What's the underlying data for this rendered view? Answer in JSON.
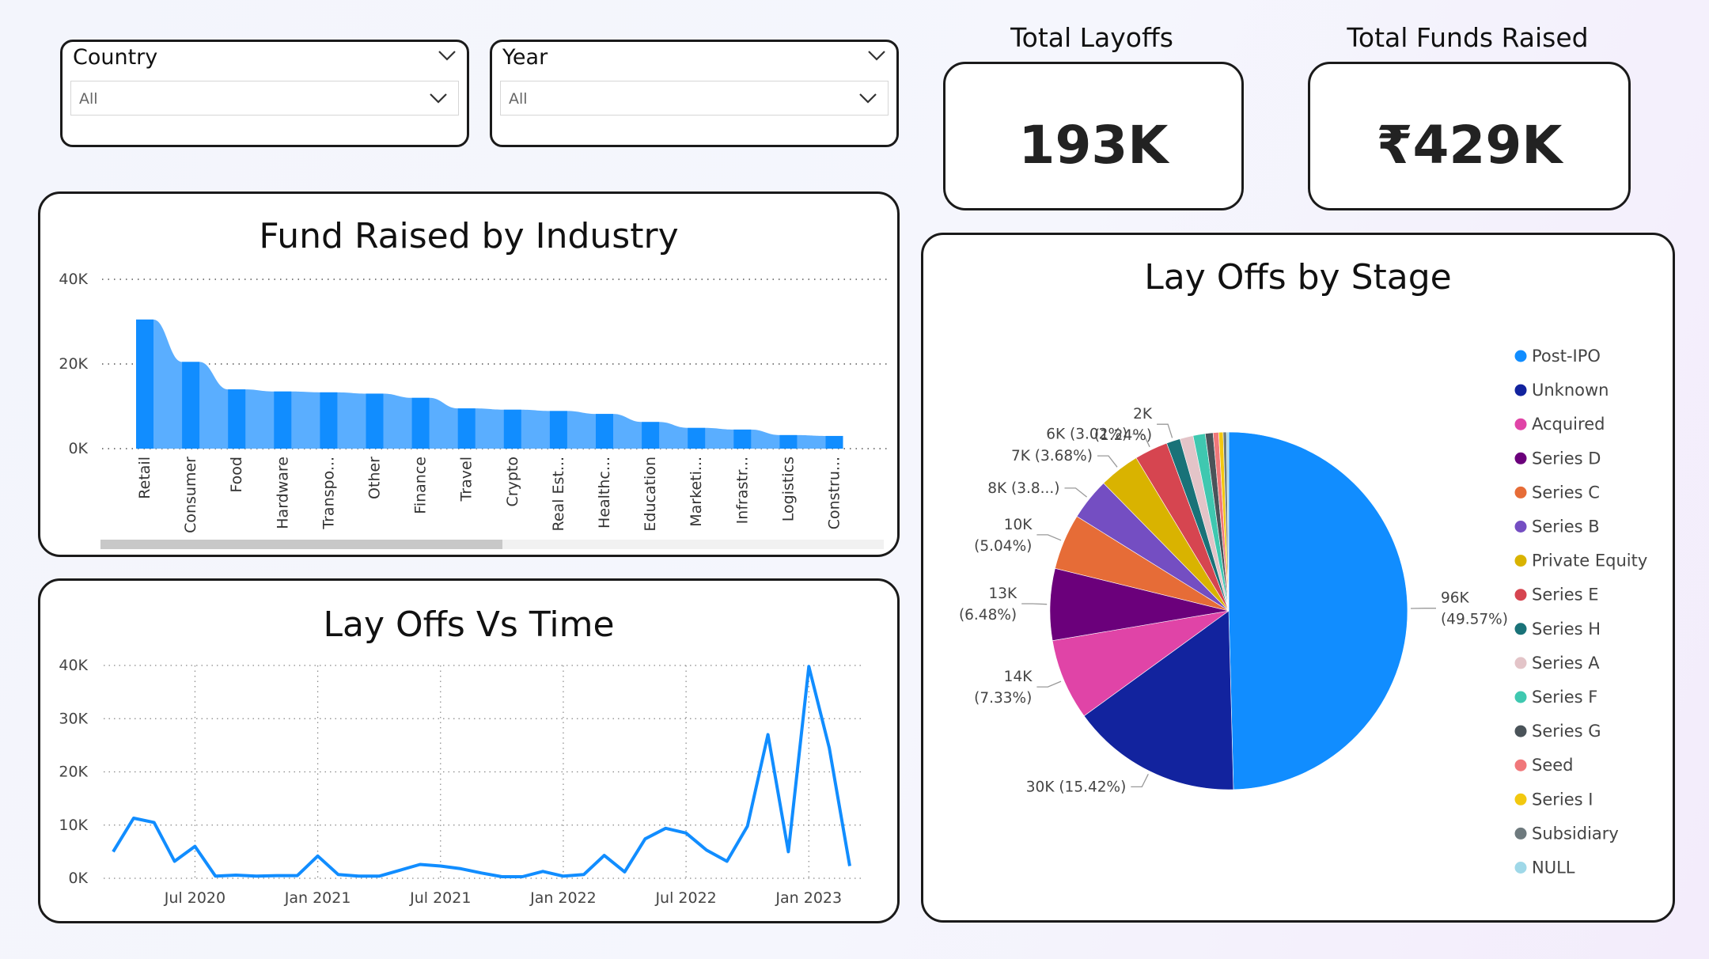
{
  "filters": {
    "country": {
      "label": "Country",
      "value": "All"
    },
    "year": {
      "label": "Year",
      "value": "All"
    }
  },
  "kpis": {
    "total_layoffs": {
      "label": "Total Layoffs",
      "value": "193K"
    },
    "total_funds": {
      "label": "Total Funds Raised",
      "value": "₹429K"
    }
  },
  "chart_data": [
    {
      "id": "fund_by_industry",
      "type": "bar",
      "title": "Fund Raised by Industry",
      "categories": [
        "Retail",
        "Consumer",
        "Food",
        "Hardware",
        "Transpo...",
        "Other",
        "Finance",
        "Travel",
        "Crypto",
        "Real Est...",
        "Healthc...",
        "Education",
        "Marketi...",
        "Infrastr...",
        "Logistics",
        "Constru..."
      ],
      "values": [
        30500,
        20500,
        14000,
        13500,
        13300,
        13000,
        12000,
        9500,
        9200,
        8900,
        8200,
        6300,
        4900,
        4500,
        3200,
        3000
      ],
      "yticks": [
        "0K",
        "20K",
        "40K"
      ],
      "ylim": [
        0,
        40000
      ],
      "grid": true,
      "colors": {
        "bar": "#118DFF",
        "ribbon": "#5AAEFF"
      }
    },
    {
      "id": "layoffs_vs_time",
      "type": "line",
      "title": "Lay Offs Vs Time",
      "x": [
        "2020-03",
        "2020-04",
        "2020-05",
        "2020-06",
        "2020-07",
        "2020-08",
        "2020-09",
        "2020-10",
        "2020-11",
        "2020-12",
        "2021-01",
        "2021-02",
        "2021-03",
        "2021-04",
        "2021-05",
        "2021-06",
        "2021-07",
        "2021-08",
        "2021-09",
        "2021-10",
        "2021-11",
        "2021-12",
        "2022-01",
        "2022-02",
        "2022-03",
        "2022-04",
        "2022-05",
        "2022-06",
        "2022-07",
        "2022-08",
        "2022-09",
        "2022-10",
        "2022-11",
        "2022-12",
        "2023-01",
        "2023-02",
        "2023-03"
      ],
      "values": [
        5000,
        11300,
        10500,
        3200,
        6000,
        400,
        600,
        400,
        500,
        500,
        4200,
        700,
        400,
        400,
        1500,
        2600,
        2300,
        1800,
        1000,
        300,
        300,
        1300,
        400,
        700,
        4300,
        1200,
        7400,
        9400,
        8500,
        5300,
        3200,
        9800,
        27000,
        5000,
        39800,
        24500,
        2300
      ],
      "xticks": [
        "Jul 2020",
        "Jan 2021",
        "Jul 2021",
        "Jan 2022",
        "Jul 2022",
        "Jan 2023"
      ],
      "xtick_dates": [
        "2020-07",
        "2021-01",
        "2021-07",
        "2022-01",
        "2022-07",
        "2023-01"
      ],
      "yticks": [
        "0K",
        "10K",
        "20K",
        "30K",
        "40K"
      ],
      "ylim": [
        0,
        40000
      ],
      "grid": true,
      "colors": {
        "line": "#118DFF"
      }
    },
    {
      "id": "layoffs_by_stage",
      "type": "pie",
      "title": "Lay Offs by Stage",
      "legend_position": "right",
      "slices": [
        {
          "name": "Post-IPO",
          "value": 49.57,
          "color": "#118DFF",
          "label": [
            "96K",
            "(49.57%)"
          ]
        },
        {
          "name": "Unknown",
          "value": 15.42,
          "color": "#12239E",
          "label": [
            "30K (15.42%)"
          ]
        },
        {
          "name": "Acquired",
          "value": 7.33,
          "color": "#E044A7",
          "label": [
            "14K",
            "(7.33%)"
          ]
        },
        {
          "name": "Series D",
          "value": 6.48,
          "color": "#6B007B",
          "label": [
            "13K",
            "(6.48%)"
          ]
        },
        {
          "name": "Series C",
          "value": 5.04,
          "color": "#E66C37",
          "label": [
            "10K",
            "(5.04%)"
          ]
        },
        {
          "name": "Series B",
          "value": 3.8,
          "color": "#744EC2",
          "label": [
            "8K (3.8...)"
          ]
        },
        {
          "name": "Private Equity",
          "value": 3.68,
          "color": "#D9B300",
          "label": [
            "7K (3.68%)"
          ]
        },
        {
          "name": "Series E",
          "value": 3.02,
          "color": "#D64550",
          "label": [
            "6K (3.02%)"
          ]
        },
        {
          "name": "Series H",
          "value": 1.24,
          "color": "#197278",
          "label": [
            "2K",
            "(1.24%)"
          ]
        },
        {
          "name": "Series A",
          "value": 1.2,
          "color": "#E3C4C8",
          "label": []
        },
        {
          "name": "Series F",
          "value": 1.1,
          "color": "#3FC8B0",
          "label": []
        },
        {
          "name": "Series G",
          "value": 0.7,
          "color": "#4A5359",
          "label": []
        },
        {
          "name": "Seed",
          "value": 0.5,
          "color": "#F0777A",
          "label": []
        },
        {
          "name": "Series I",
          "value": 0.4,
          "color": "#F2C80F",
          "label": []
        },
        {
          "name": "Subsidiary",
          "value": 0.3,
          "color": "#6E7A7E",
          "label": []
        },
        {
          "name": "NULL",
          "value": 0.2,
          "color": "#9FD8E8",
          "label": []
        }
      ]
    }
  ]
}
